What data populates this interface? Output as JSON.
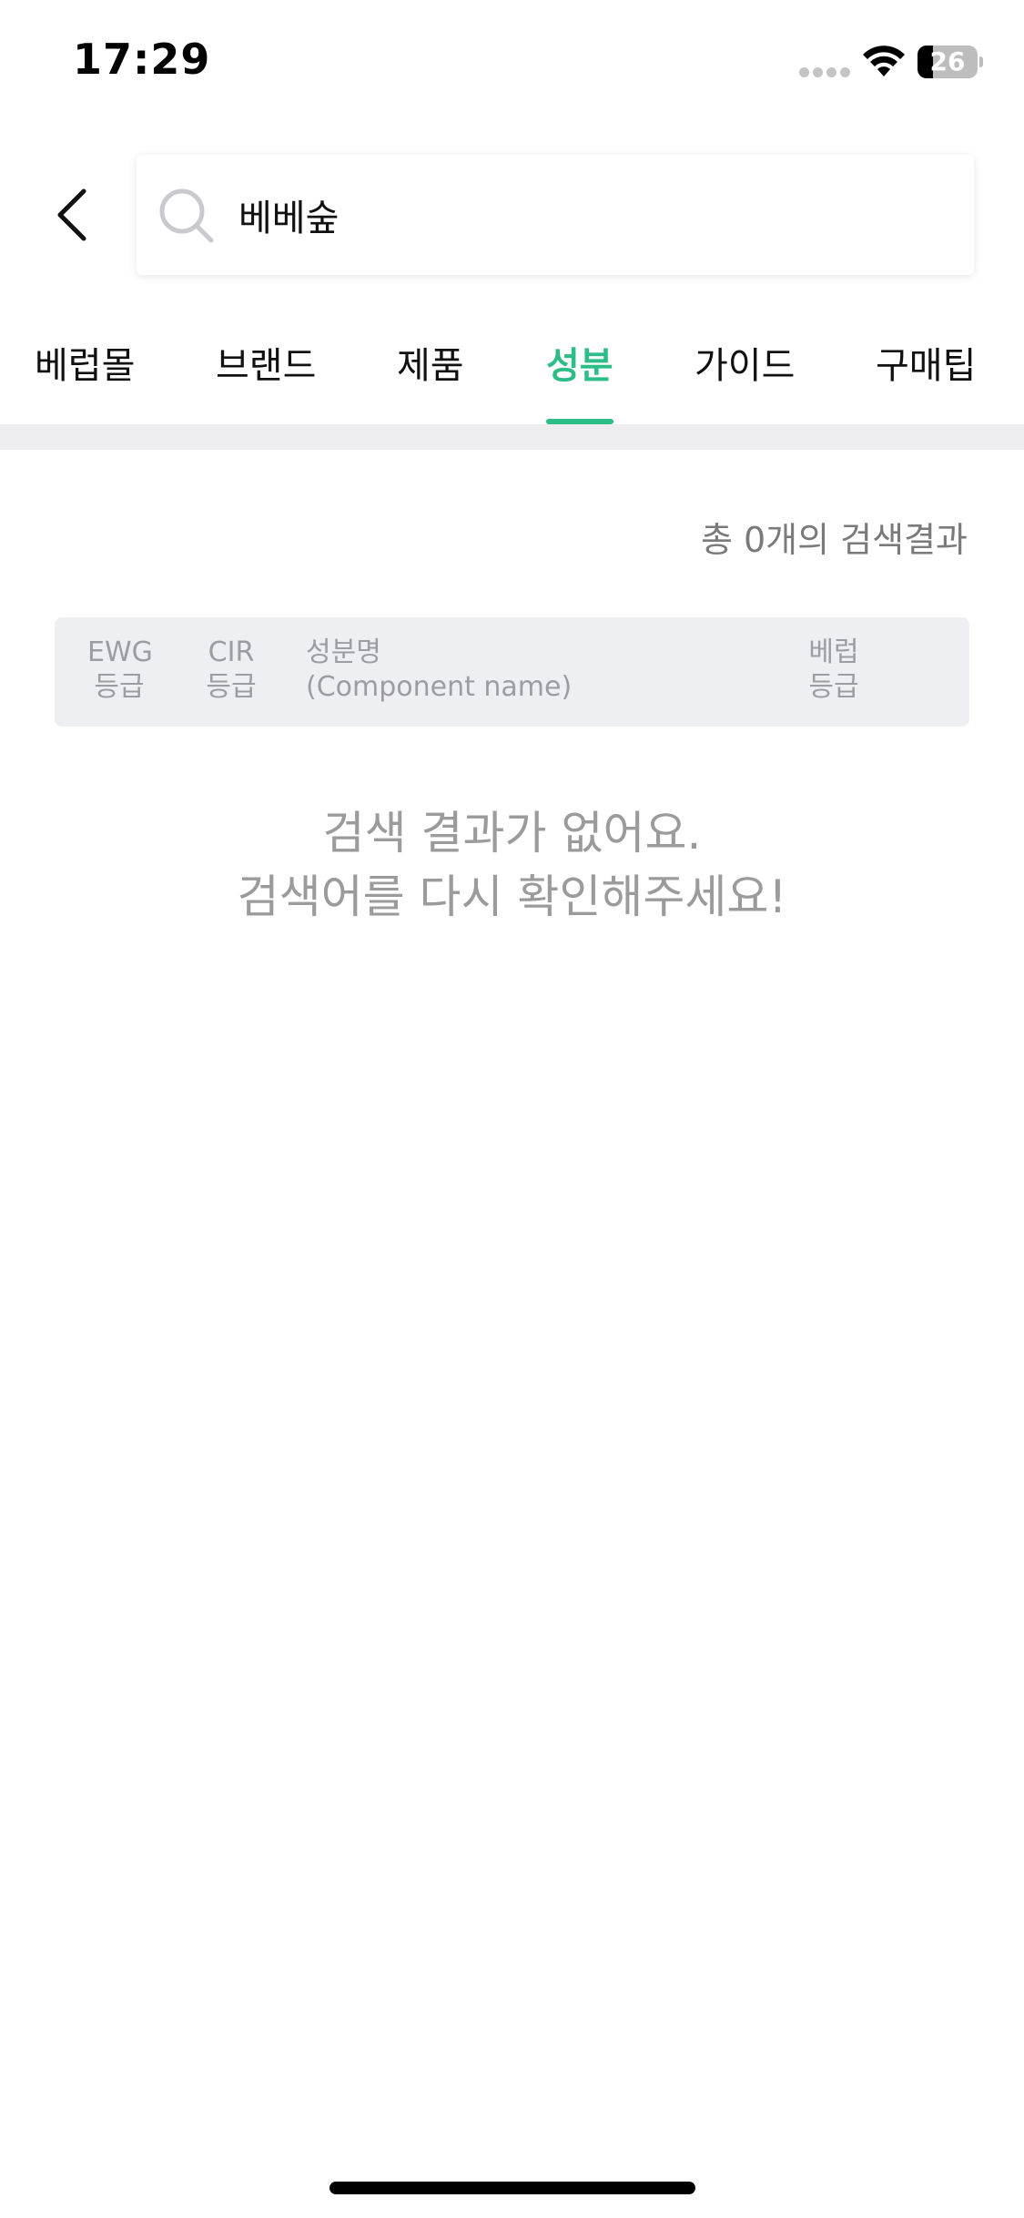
{
  "status_bar": {
    "time": "17:29",
    "battery_level": "26",
    "battery_fraction": 0.26
  },
  "header": {
    "back_icon": "chevron-left-icon",
    "search_icon": "search-icon",
    "search_value": "베베숲"
  },
  "tabs": [
    {
      "label": "베럽몰",
      "active": false
    },
    {
      "label": "브랜드",
      "active": false
    },
    {
      "label": "제품",
      "active": false
    },
    {
      "label": "성분",
      "active": true
    },
    {
      "label": "가이드",
      "active": false
    },
    {
      "label": "구매팁",
      "active": false
    }
  ],
  "results": {
    "count_text": "총 0개의 검색결과"
  },
  "table": {
    "columns": [
      {
        "line1": "EWG",
        "line2": "등급"
      },
      {
        "line1": "CIR",
        "line2": "등급"
      },
      {
        "line1": "성분명",
        "line2": "(Component name)"
      },
      {
        "line1": "베럽",
        "line2": "등급"
      }
    ]
  },
  "empty_state": {
    "line1": "검색 결과가 없어요.",
    "line2": "검색어를 다시 확인해주세요!"
  },
  "colors": {
    "accent": "#2dbd86",
    "muted_text": "#9b9b9b",
    "header_bg": "#eeeff2"
  }
}
